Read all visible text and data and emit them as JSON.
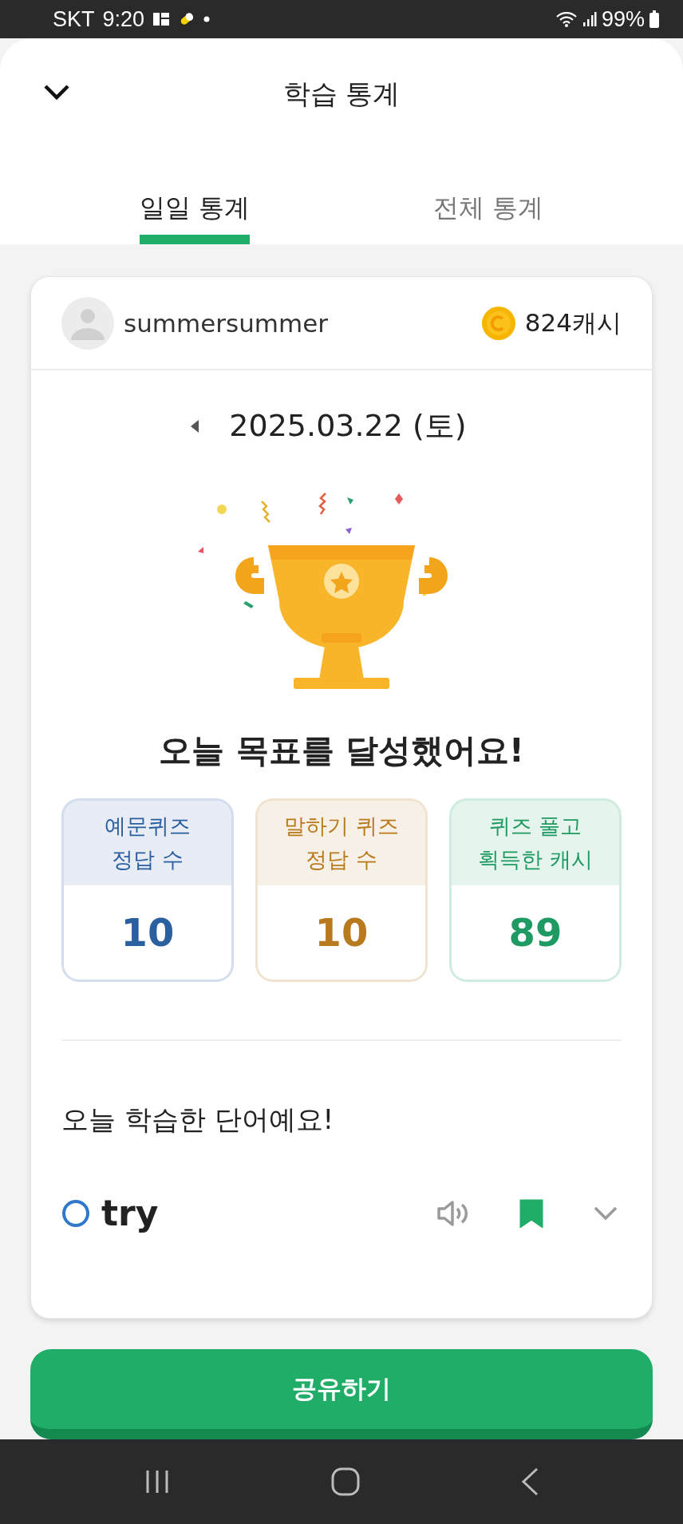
{
  "status_bar": {
    "carrier": "SKT",
    "time": "9:20",
    "battery": "99%"
  },
  "header": {
    "title": "학습 통계"
  },
  "tabs": [
    {
      "label": "일일 통계",
      "selected": true
    },
    {
      "label": "전체 통계",
      "selected": false
    }
  ],
  "profile": {
    "username": "summersummer",
    "cash": "824캐시"
  },
  "date": "2025.03.22 (토)",
  "headline": "오늘 목표를 달성했어요!",
  "stats": [
    {
      "label": "예문퀴즈\n정답 수",
      "value": "10",
      "color": "#2a5fa0"
    },
    {
      "label": "말하기 퀴즈\n정답 수",
      "value": "10",
      "color": "#b87a1c"
    },
    {
      "label": "퀴즈 풀고\n획득한 캐시",
      "value": "89",
      "color": "#1f9a62"
    }
  ],
  "words_title": "오늘 학습한 단어예요!",
  "words": [
    {
      "word": "try",
      "correct": true,
      "bookmarked": true
    }
  ],
  "share_button": "공유하기"
}
